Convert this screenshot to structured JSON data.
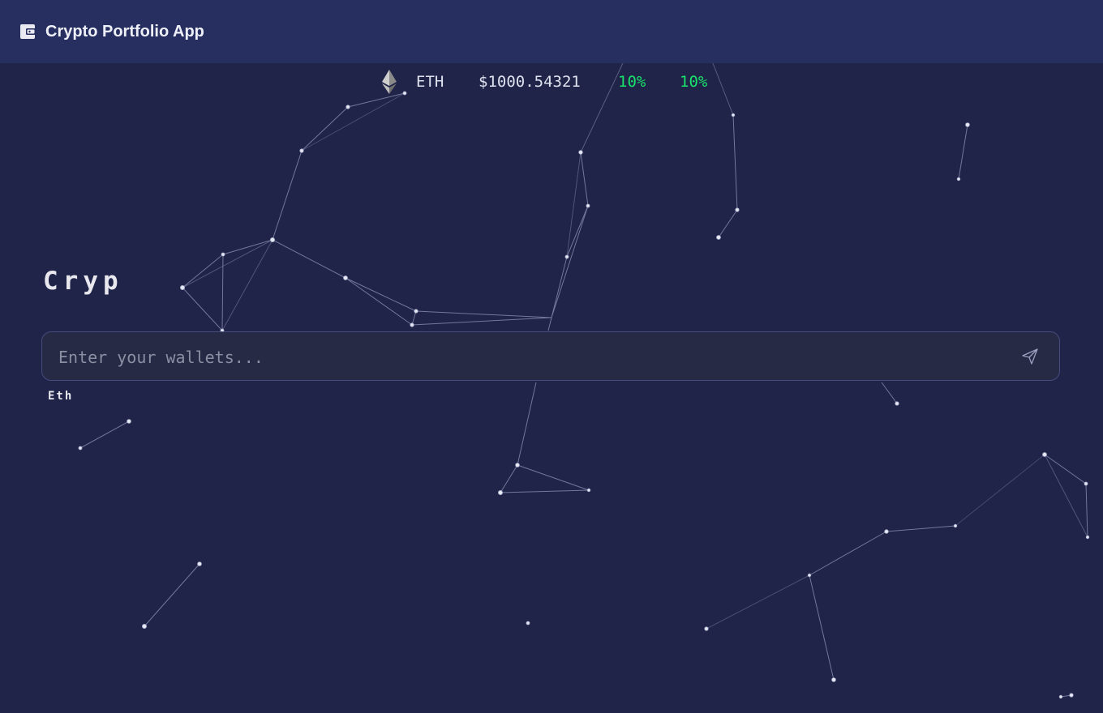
{
  "app": {
    "title": "Crypto Portfolio App",
    "icon": "wallet-icon"
  },
  "ticker": {
    "icon": "ethereum-logo-icon",
    "symbol": "ETH",
    "price": "$1000.54321",
    "change_1": "10%",
    "change_2": "10%",
    "change_color": "#19e36b"
  },
  "main": {
    "heading": "Cryp",
    "wallet_input": {
      "placeholder": "Enter your wallets...",
      "value": ""
    },
    "send_icon": "send-icon",
    "sub_label": "Eth"
  },
  "colors": {
    "background": "#1f2448",
    "header": "#272f61",
    "input_bg": "#272a45",
    "positive": "#19e36b"
  }
}
